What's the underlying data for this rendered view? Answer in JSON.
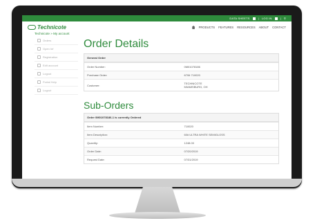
{
  "topbar": {
    "data_sheets": "DATA SHEETS",
    "login": "LOG IN"
  },
  "logo": {
    "text": "Technicote"
  },
  "nav": [
    "PRODUCTS",
    "FEATURES",
    "RESOURCES",
    "ABOUT",
    "CONTACT"
  ],
  "breadcrumb": "Technicote » My account",
  "sidebar": [
    "Orders",
    "Open Inf",
    "Registration",
    "Edit account",
    "Logout",
    "Portal Help",
    "Logout"
  ],
  "order_details": {
    "title": "Order Details",
    "section": "General Order",
    "rows": [
      {
        "label": "Order Number:",
        "value": "0M01078186"
      },
      {
        "label": "Purchase Order:",
        "value": "6706 710020"
      },
      {
        "label": "Customer:",
        "value": "TECHNICOTE\nMIAMISBURG, OH"
      }
    ]
  },
  "sub_orders": {
    "title": "Sub-Orders",
    "section": "Order 0M01078186-1 is currently Ordered",
    "rows": [
      {
        "label": "Item Number:",
        "value": "710020"
      },
      {
        "label": "Item Description:",
        "value": "60# ULTRA WHITE SEMIGLOSS"
      },
      {
        "label": "Quantity:",
        "value": "1248.00"
      },
      {
        "label": "Order Date:",
        "value": "07/20/2019"
      },
      {
        "label": "Request Date:",
        "value": "07/31/2019"
      }
    ]
  },
  "colors": {
    "brand": "#2e8b3c"
  }
}
